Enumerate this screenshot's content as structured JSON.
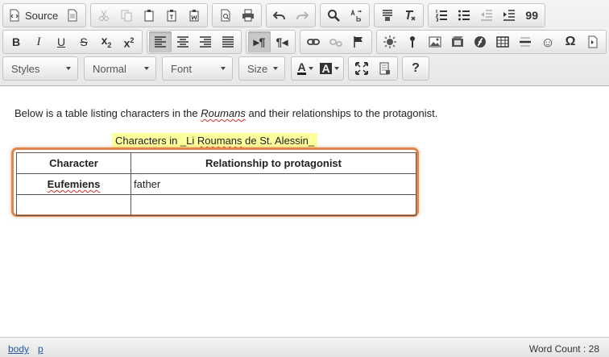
{
  "toolbar": {
    "source_label": "Source",
    "styles": {
      "value": "Styles"
    },
    "format": {
      "value": "Normal"
    },
    "font": {
      "value": "Font"
    },
    "size": {
      "value": "Size"
    },
    "help_label": "?",
    "subscript_label": "x",
    "superscript_label": "x",
    "strike_label": "S",
    "bold_label": "B",
    "italic_label": "I",
    "underline_label": "U",
    "ltr_label": "¶",
    "rtl_label": "¶",
    "omega_label": "Ω",
    "smiley_label": "☺",
    "text_color_label": "A",
    "bg_color_label": "A",
    "sub_mark": "2",
    "sup_mark": "2",
    "quote_label": "99",
    "accent": "#e0864a"
  },
  "content": {
    "para_before": "Below is a table listing characters in the ",
    "para_italic": "Roumans",
    "para_after": " and their relationships to the protagonist.",
    "caption_prefix": "Characters in _Li ",
    "caption_word": "Roumans",
    "caption_suffix": " de St. Alessin_",
    "table": {
      "headers": [
        "Character",
        "Relationship to protagonist"
      ],
      "rows": [
        [
          "Eufemiens",
          "father"
        ],
        [
          "",
          ""
        ]
      ]
    }
  },
  "status": {
    "path": [
      "body",
      "p"
    ],
    "word_count": "Word Count : 28"
  }
}
